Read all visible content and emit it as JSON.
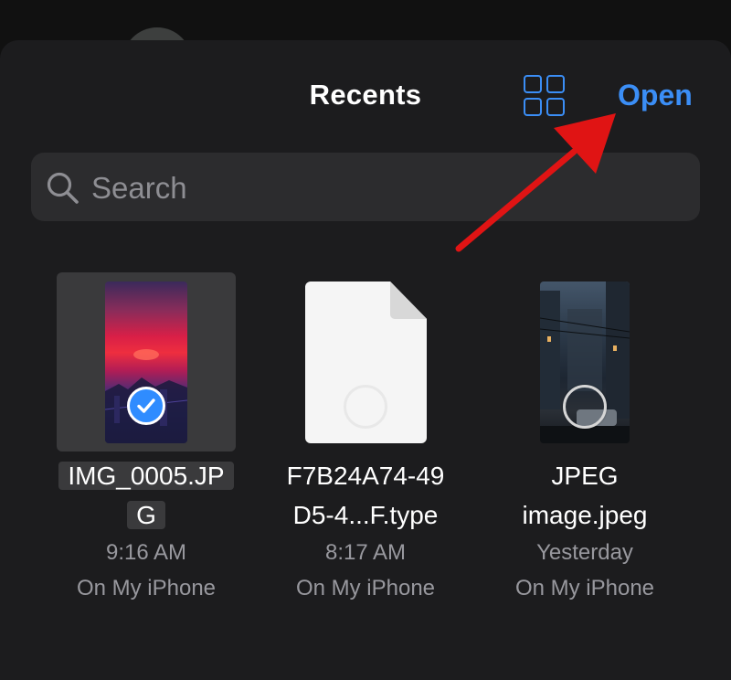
{
  "header": {
    "title": "Recents",
    "open_label": "Open"
  },
  "search": {
    "placeholder": "Search"
  },
  "files": [
    {
      "name_line1": "IMG_0005.JP",
      "name_line2": "G",
      "time": "9:16 AM",
      "location": "On My iPhone",
      "selected": true
    },
    {
      "name_line1": "F7B24A74-49",
      "name_line2": "D5-4...F.type",
      "time": "8:17 AM",
      "location": "On My iPhone",
      "selected": false
    },
    {
      "name_line1": "JPEG",
      "name_line2": "image.jpeg",
      "time": "Yesterday",
      "location": "On My iPhone",
      "selected": false
    }
  ],
  "colors": {
    "accent": "#3b8ef6",
    "sheet": "#1c1c1e",
    "annotation_arrow": "#e01414"
  },
  "icons": [
    "grid-view-icon",
    "search-icon",
    "checkmark-icon",
    "document-icon"
  ]
}
